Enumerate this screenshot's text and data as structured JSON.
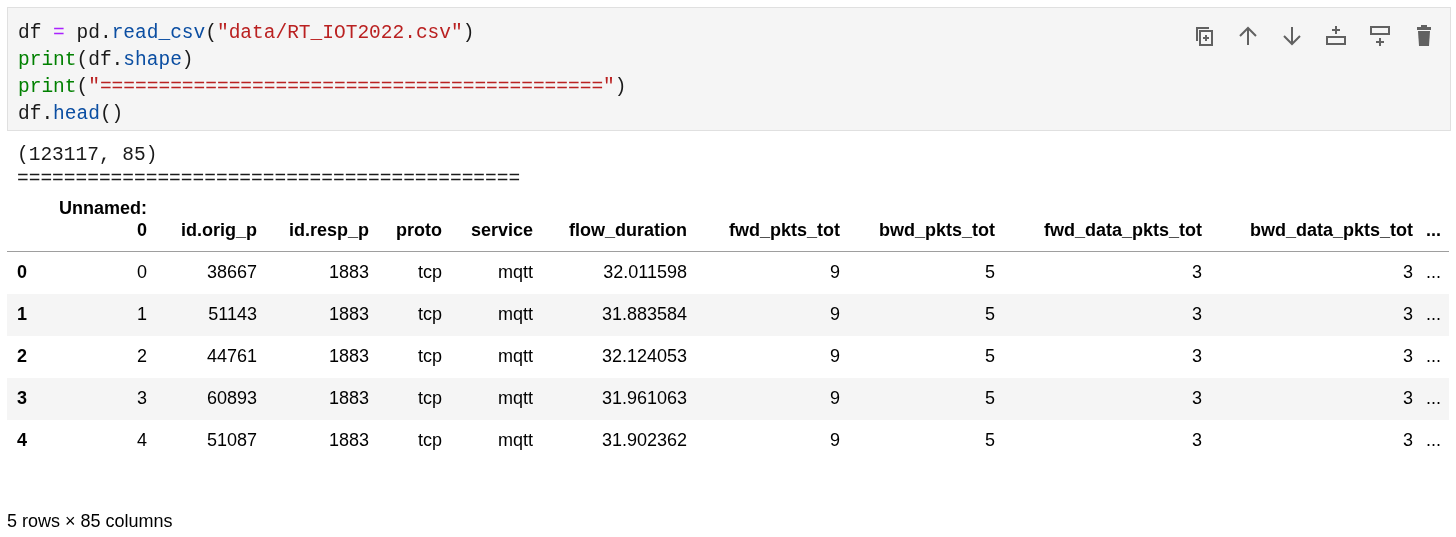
{
  "code_cell": {
    "lines": [
      [
        {
          "text": "df ",
          "kind": "plain"
        },
        {
          "text": "=",
          "kind": "operator"
        },
        {
          "text": " pd.",
          "kind": "plain"
        },
        {
          "text": "read_csv",
          "kind": "attribute"
        },
        {
          "text": "(",
          "kind": "plain"
        },
        {
          "text": "\"data/RT_IOT2022.csv\"",
          "kind": "string"
        },
        {
          "text": ")",
          "kind": "plain"
        }
      ],
      [
        {
          "text": "print",
          "kind": "builtin"
        },
        {
          "text": "(df.",
          "kind": "plain"
        },
        {
          "text": "shape",
          "kind": "attribute"
        },
        {
          "text": ")",
          "kind": "plain"
        }
      ],
      [
        {
          "text": "print",
          "kind": "builtin"
        },
        {
          "text": "(",
          "kind": "plain"
        },
        {
          "text": "\"===========================================\"",
          "kind": "string"
        },
        {
          "text": ")",
          "kind": "plain"
        }
      ],
      [
        {
          "text": "df.",
          "kind": "plain"
        },
        {
          "text": "head",
          "kind": "attribute"
        },
        {
          "text": "()",
          "kind": "plain"
        }
      ]
    ],
    "toolbar": [
      {
        "kind": "duplicate"
      },
      {
        "kind": "move-up"
      },
      {
        "kind": "move-down"
      },
      {
        "kind": "insert-above"
      },
      {
        "kind": "insert-below"
      },
      {
        "kind": "delete"
      }
    ]
  },
  "output": {
    "stdout": [
      "(123117, 85)",
      "==========================================="
    ],
    "table": {
      "columns": [
        "",
        "Unnamed: 0",
        "id.orig_p",
        "id.resp_p",
        "proto",
        "service",
        "flow_duration",
        "fwd_pkts_tot",
        "bwd_pkts_tot",
        "fwd_data_pkts_tot",
        "bwd_data_pkts_tot",
        "..."
      ],
      "rows": [
        [
          "0",
          "0",
          "38667",
          "1883",
          "tcp",
          "mqtt",
          "32.011598",
          "9",
          "5",
          "3",
          "3",
          "..."
        ],
        [
          "1",
          "1",
          "51143",
          "1883",
          "tcp",
          "mqtt",
          "31.883584",
          "9",
          "5",
          "3",
          "3",
          "..."
        ],
        [
          "2",
          "2",
          "44761",
          "1883",
          "tcp",
          "mqtt",
          "32.124053",
          "9",
          "5",
          "3",
          "3",
          "..."
        ],
        [
          "3",
          "3",
          "60893",
          "1883",
          "tcp",
          "mqtt",
          "31.961063",
          "9",
          "5",
          "3",
          "3",
          "..."
        ],
        [
          "4",
          "4",
          "51087",
          "1883",
          "tcp",
          "mqtt",
          "31.902362",
          "9",
          "5",
          "3",
          "3",
          "..."
        ]
      ]
    },
    "summary": "5 rows × 85 columns"
  }
}
